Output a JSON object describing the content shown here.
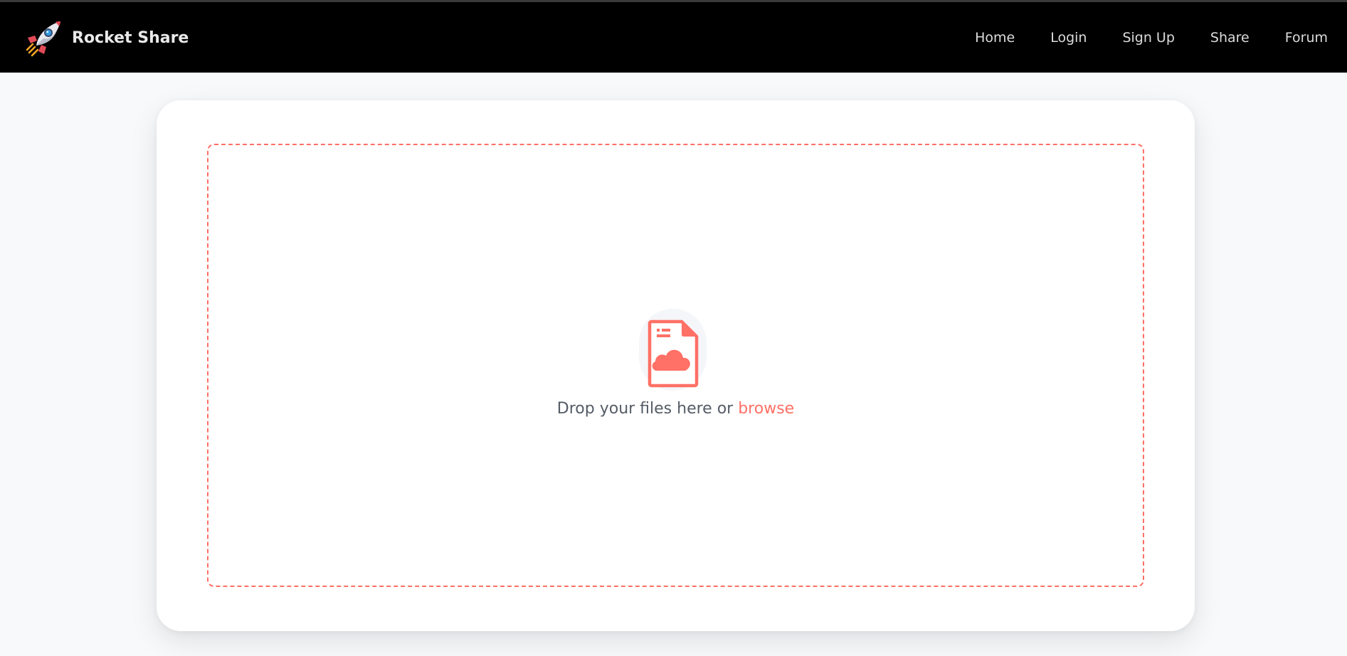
{
  "brand": {
    "name": "Rocket Share",
    "logo_icon": "rocket-icon"
  },
  "nav": {
    "items": [
      {
        "label": "Home"
      },
      {
        "label": "Login"
      },
      {
        "label": "Sign Up"
      },
      {
        "label": "Share"
      },
      {
        "label": "Forum"
      }
    ]
  },
  "upload": {
    "icon": "file-cloud-icon",
    "prompt": "Drop your files here or",
    "browse_label": "browse"
  },
  "colors": {
    "navbar_bg": "#000000",
    "accent": "#ff7066",
    "page_bg": "#f8f9fb",
    "card_bg": "#ffffff"
  }
}
